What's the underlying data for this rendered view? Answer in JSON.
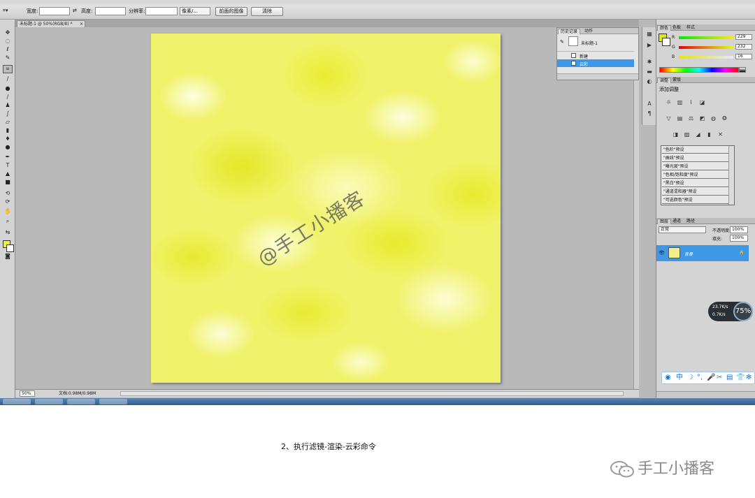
{
  "options_bar": {
    "width_label": "宽度:",
    "height_label": "高度:",
    "resolution_label": "分辨率:",
    "units_value": "像素/...",
    "front_image_button": "前面的图像",
    "clear_button": "清除"
  },
  "document": {
    "tab_title": "未标题-1 @ 50%(RGB/8) *",
    "watermark": "@手工小播客"
  },
  "status_bar": {
    "zoom": "50%",
    "doc_info": "文档:0.98M/0.98M"
  },
  "history_panel": {
    "tabs": [
      "历史记录",
      "动作"
    ],
    "snapshot_label": "未标题-1",
    "steps": [
      "新建",
      "云彩"
    ],
    "selected_step": "云彩"
  },
  "color_panel": {
    "tabs": [
      "颜色",
      "色板",
      "样式"
    ],
    "foreground": "#e5e810",
    "channels": [
      {
        "label": "R",
        "value": "229"
      },
      {
        "label": "G",
        "value": "232"
      },
      {
        "label": "B",
        "value": "16"
      }
    ]
  },
  "adjustments_panel": {
    "tabs": [
      "调整",
      "蒙版"
    ],
    "title": "添加调整",
    "presets": [
      "\"色阶\"预设",
      "\"曲线\"预设",
      "\"曝光度\"预设",
      "\"色相/饱和度\"预设",
      "\"黑白\"预设",
      "\"通道混和器\"预设",
      "\"可选颜色\"预设"
    ]
  },
  "layers_panel": {
    "tabs": [
      "图层",
      "通道",
      "路径"
    ],
    "blend_mode": "正常",
    "opacity_label": "不透明度:",
    "opacity": "100%",
    "fill_label": "填充:",
    "fill": "100%",
    "layer_name": "背景"
  },
  "network_badge": {
    "upload": "23.7K/s",
    "download": "0.7K/s",
    "percent": "75%"
  },
  "ime_bar": {
    "lang": "中"
  },
  "caption": "2、执行滤镜-渲染-云彩命令",
  "brand": "手工小播客"
}
